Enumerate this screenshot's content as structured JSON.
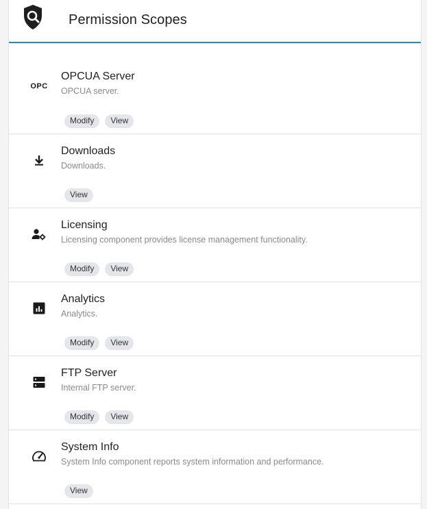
{
  "header": {
    "title": "Permission Scopes",
    "icon": "shield-search-icon"
  },
  "scopes": [
    {
      "name": "OPCUA Server",
      "description": "OPCUA server.",
      "icon_text": "OPC",
      "icon": "opc-icon",
      "permissions": [
        "Modify",
        "View"
      ]
    },
    {
      "name": "Downloads",
      "description": "Downloads.",
      "icon": "download-icon",
      "permissions": [
        "View"
      ]
    },
    {
      "name": "Licensing",
      "description": "Licensing component provides license management functionality.",
      "icon": "user-gear-icon",
      "permissions": [
        "Modify",
        "View"
      ]
    },
    {
      "name": "Analytics",
      "description": "Analytics.",
      "icon": "analytics-icon",
      "permissions": [
        "Modify",
        "View"
      ]
    },
    {
      "name": "FTP Server",
      "description": "Internal FTP server.",
      "icon": "server-icon",
      "permissions": [
        "Modify",
        "View"
      ]
    },
    {
      "name": "System Info",
      "description": "System Info component reports system information and performance.",
      "icon": "speedometer-icon",
      "permissions": [
        "View"
      ]
    }
  ],
  "colors": {
    "accent": "#2f7fd3",
    "chip_bg": "#e3e6eb",
    "title_text": "#222222",
    "desc_text": "#8a8a8a"
  }
}
